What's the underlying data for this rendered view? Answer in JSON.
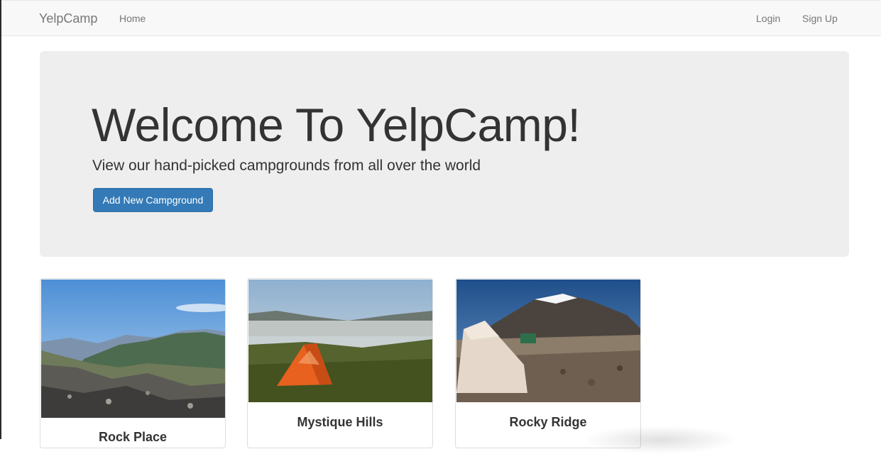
{
  "navbar": {
    "brand": "YelpCamp",
    "home": "Home",
    "login": "Login",
    "signup": "Sign Up"
  },
  "jumbotron": {
    "title": "Welcome To YelpCamp!",
    "subtitle": "View our hand-picked campgrounds from all over the world",
    "button_label": "Add New Campground"
  },
  "campgrounds": [
    {
      "name": "Rock Place"
    },
    {
      "name": "Mystique Hills"
    },
    {
      "name": "Rocky Ridge"
    }
  ],
  "colors": {
    "primary": "#337ab7",
    "navbar_bg": "#f8f8f8",
    "jumbotron_bg": "#eeeeee"
  }
}
